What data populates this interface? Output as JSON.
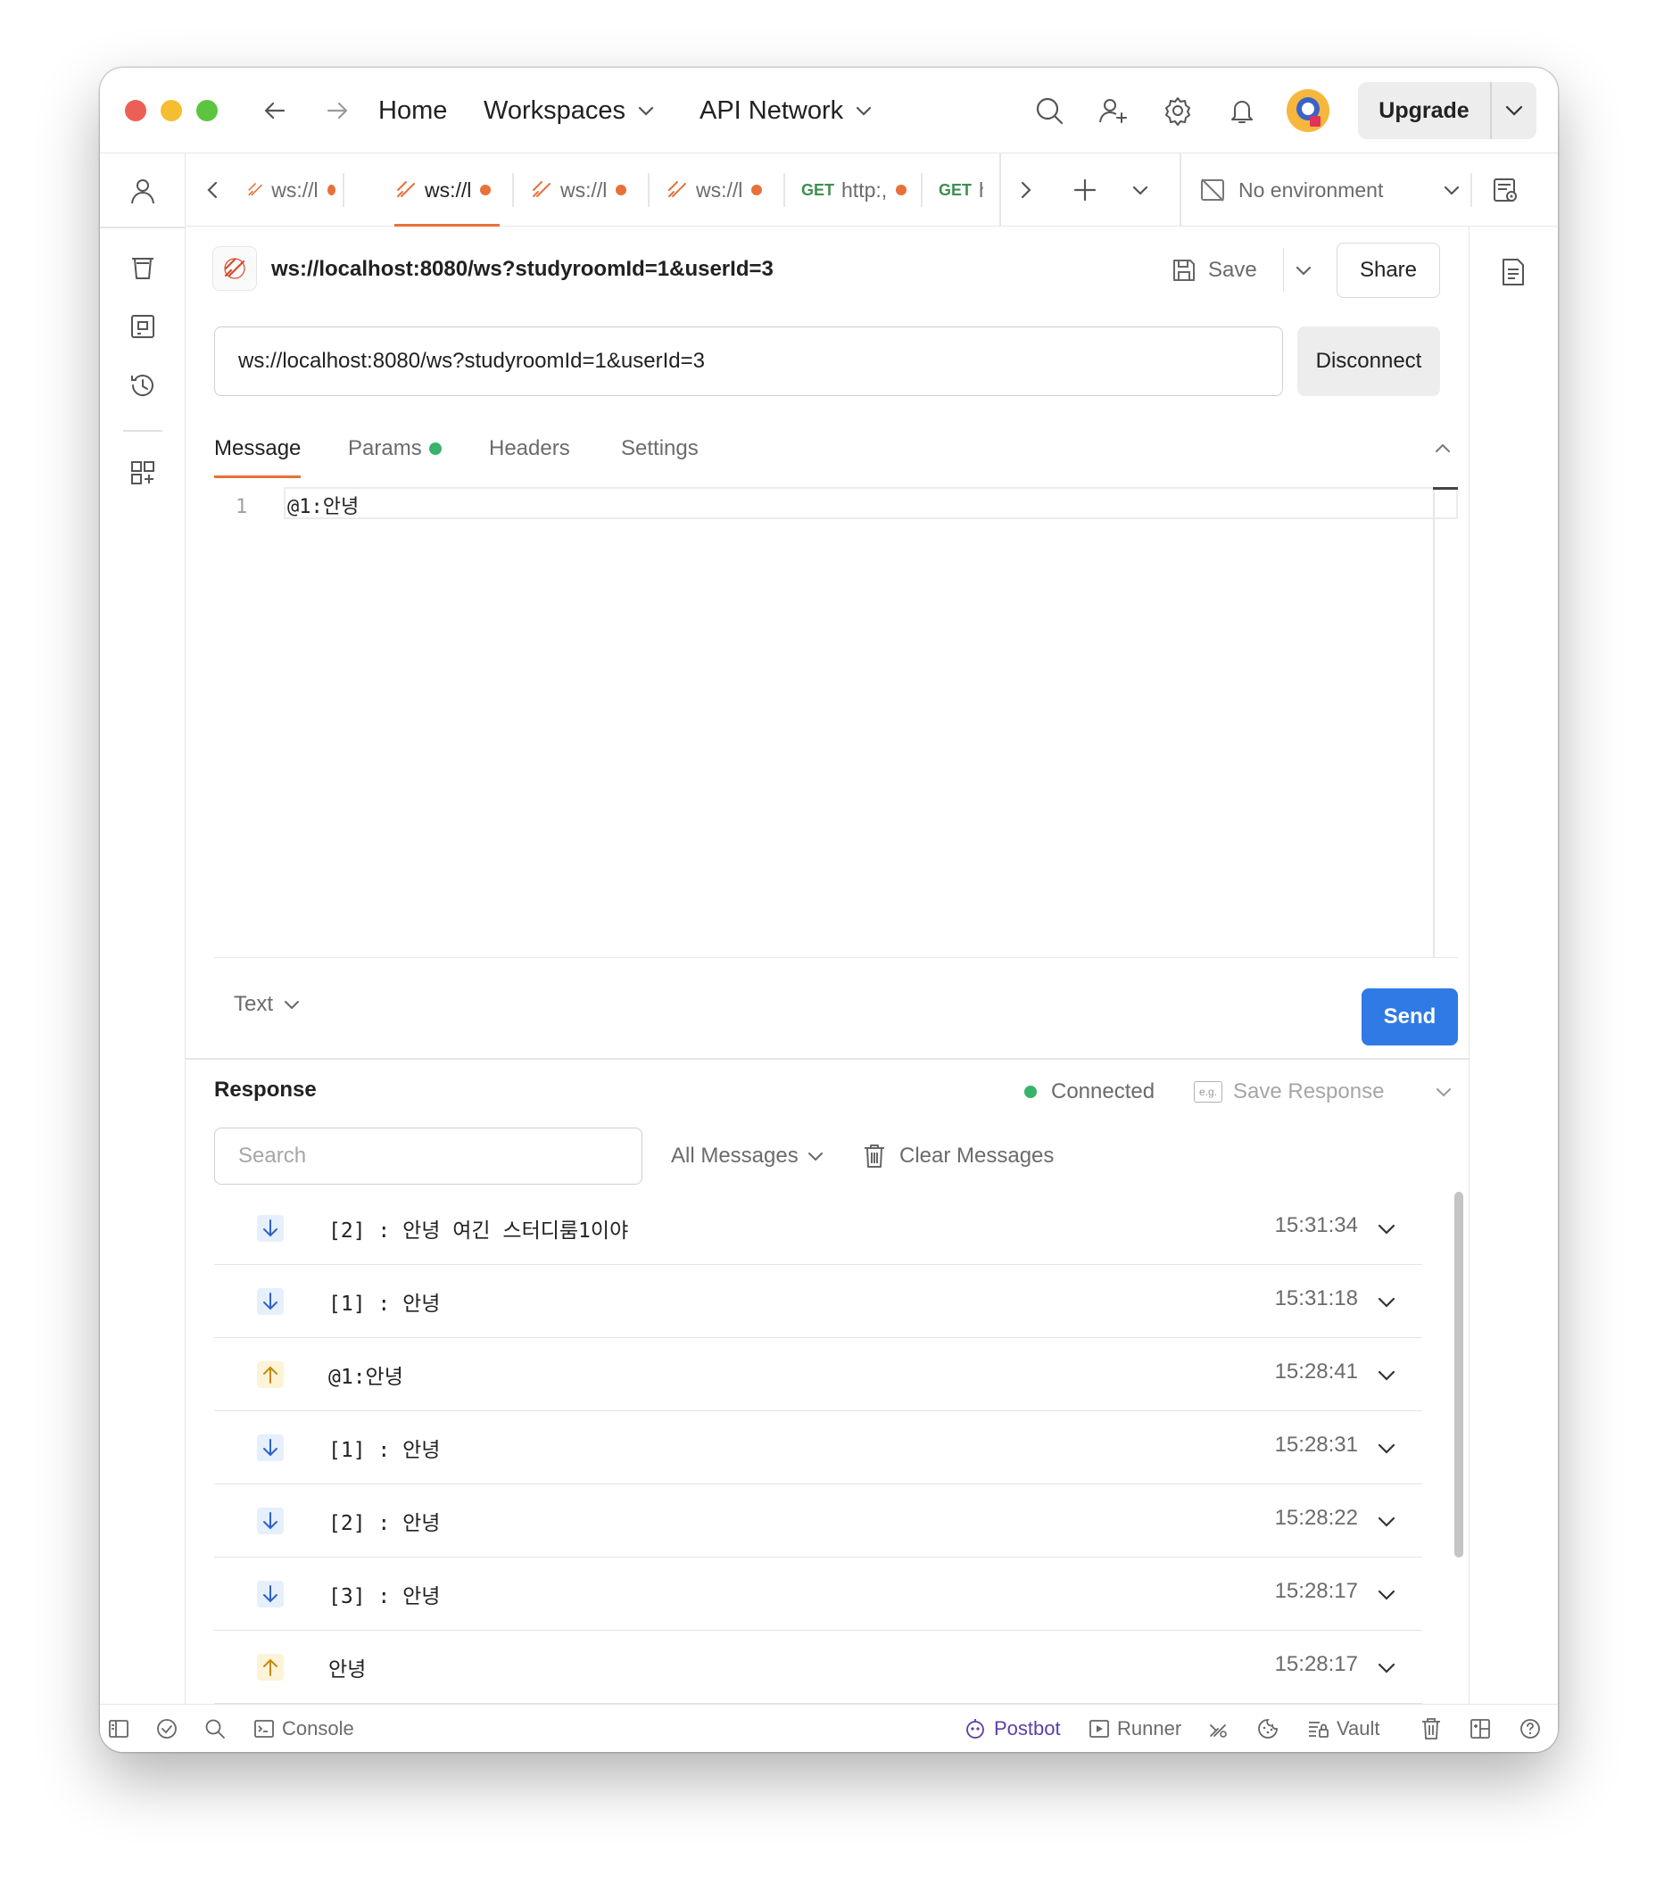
{
  "titlebar": {
    "nav": {
      "home": "Home",
      "workspaces": "Workspaces",
      "api_network": "API Network"
    },
    "upgrade_label": "Upgrade"
  },
  "tabs": [
    {
      "label": "ws://l",
      "method": "",
      "active": false
    },
    {
      "label": "ws://l",
      "method": "",
      "active": true
    },
    {
      "label": "ws://l",
      "method": "",
      "active": false
    },
    {
      "label": "ws://l",
      "method": "",
      "active": false
    },
    {
      "label": "http:,",
      "method": "GET",
      "active": false
    },
    {
      "label": "h",
      "method": "GET",
      "active": false
    }
  ],
  "environment": {
    "label": "No environment"
  },
  "request": {
    "title": "ws://localhost:8080/ws?studyroomId=1&userId=3",
    "url": "ws://localhost:8080/ws?studyroomId=1&userId=3",
    "save_label": "Save",
    "share_label": "Share",
    "disconnect_label": "Disconnect",
    "subtabs": {
      "message": "Message",
      "params": "Params",
      "headers": "Headers",
      "settings": "Settings"
    },
    "editor": {
      "line_number": "1",
      "content": "@1:안녕"
    },
    "format_label": "Text",
    "send_label": "Send"
  },
  "response": {
    "title": "Response",
    "status": "Connected",
    "save_response_label": "Save Response",
    "eg_label": "e.g.",
    "search_placeholder": "Search",
    "filter_label": "All Messages",
    "clear_label": "Clear Messages",
    "messages": [
      {
        "direction": "in",
        "text": "[2] : 안녕 여긴 스터디룸1이야",
        "time": "15:31:34"
      },
      {
        "direction": "in",
        "text": "[1] : 안녕",
        "time": "15:31:18"
      },
      {
        "direction": "out",
        "text": "@1:안녕",
        "time": "15:28:41"
      },
      {
        "direction": "in",
        "text": "[1] : 안녕",
        "time": "15:28:31"
      },
      {
        "direction": "in",
        "text": "[2] : 안녕",
        "time": "15:28:22"
      },
      {
        "direction": "in",
        "text": "[3] : 안녕",
        "time": "15:28:17"
      },
      {
        "direction": "out",
        "text": "안녕",
        "time": "15:28:17"
      }
    ]
  },
  "statusbar": {
    "console": "Console",
    "postbot": "Postbot",
    "runner": "Runner",
    "vault": "Vault"
  },
  "colors": {
    "accent_orange": "#e8703a",
    "send_blue": "#2f7ae5",
    "connected_green": "#38b36a",
    "postbot_purple": "#5b3fa8",
    "traffic_red": "#ec5f57",
    "traffic_yellow": "#f5bd30",
    "traffic_green": "#5dc43f"
  }
}
